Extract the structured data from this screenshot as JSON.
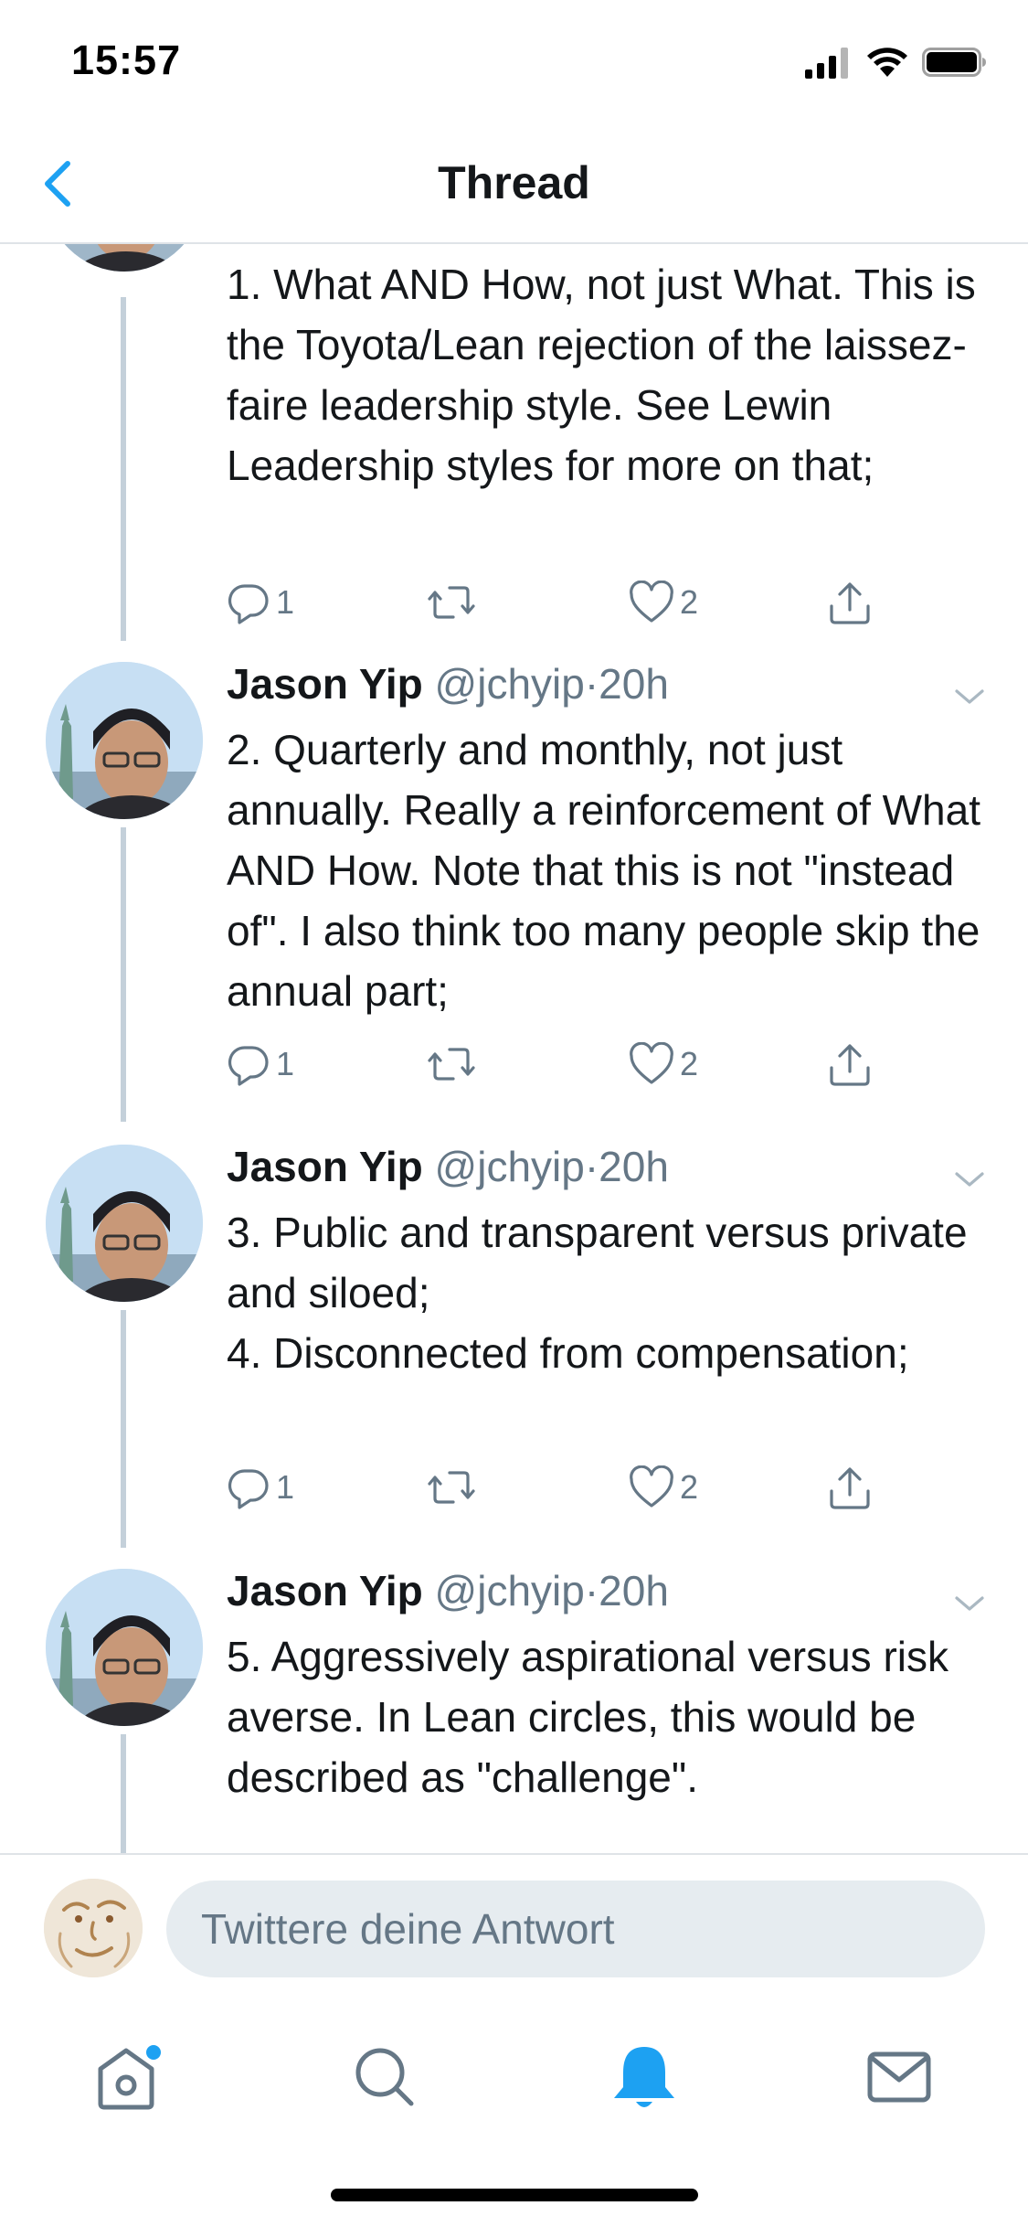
{
  "status_bar": {
    "time": "15:57"
  },
  "nav": {
    "title": "Thread"
  },
  "tweets": [
    {
      "name": "",
      "handle": "",
      "separator": "",
      "time": "",
      "text": "1. What AND How, not just What. This is the Toyota/Lean rejection of the laissez-faire leadership style. See Lewin Leadership styles for more on that;",
      "replies": "1",
      "likes": "2"
    },
    {
      "name": "Jason Yip",
      "handle": "@jchyip",
      "separator": "·",
      "time": "20h",
      "text": "2. Quarterly and monthly, not just annually. Really a reinforcement of What AND How.  Note that this is not \"instead of\". I also think too many people skip the annual part;",
      "replies": "1",
      "likes": "2"
    },
    {
      "name": "Jason Yip",
      "handle": "@jchyip",
      "separator": "·",
      "time": "20h",
      "text": "3. Public and transparent versus private and siloed;\n4. Disconnected from compensation;",
      "replies": "1",
      "likes": "2"
    },
    {
      "name": "Jason Yip",
      "handle": "@jchyip",
      "separator": "·",
      "time": "20h",
      "text": "5. Aggressively aspirational versus risk averse. In Lean circles, this would be described as \"challenge\".",
      "replies": "",
      "likes": ""
    }
  ],
  "reply": {
    "placeholder": "Twittere deine Antwort"
  },
  "tab_bar": {
    "items": [
      "home-icon",
      "search-icon",
      "notifications-icon",
      "messages-icon"
    ],
    "active": "notifications-icon",
    "has_unread_dot": true
  },
  "colors": {
    "accent": "#1da1f2",
    "text": "#14171a",
    "secondary": "#657786",
    "thread_line": "#c4d0da"
  }
}
